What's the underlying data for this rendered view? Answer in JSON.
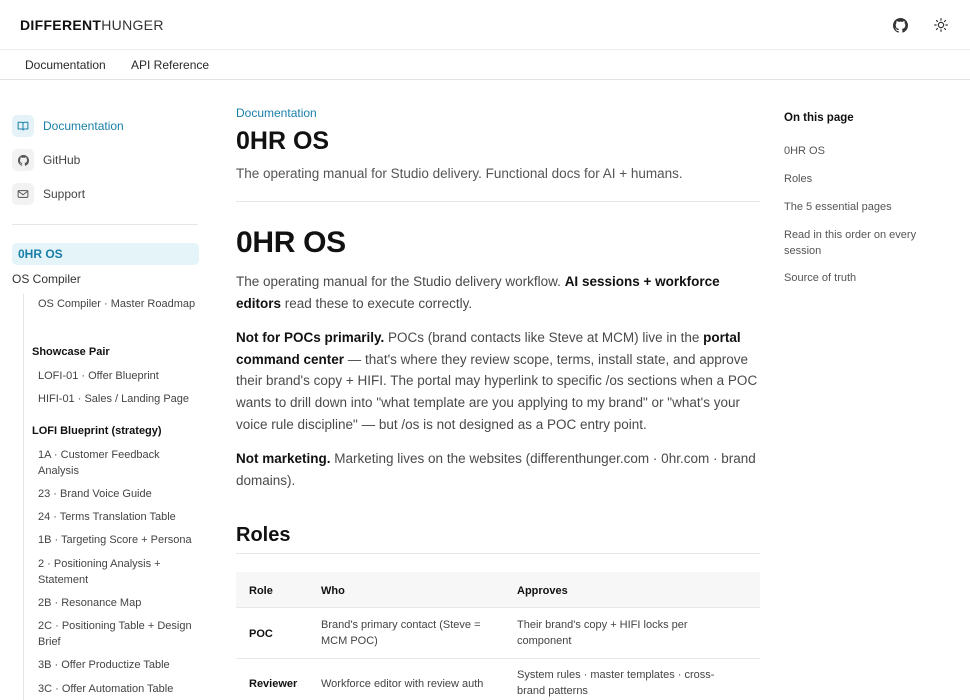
{
  "header": {
    "logo_bold": "DIFFERENT",
    "logo_thin": "HUNGER",
    "github_icon": "github-icon",
    "theme_icon": "sun-icon"
  },
  "tabs": [
    "Documentation",
    "API Reference"
  ],
  "sidebar": {
    "links": [
      {
        "label": "Documentation",
        "icon": "book-icon"
      },
      {
        "label": "GitHub",
        "icon": "github-icon"
      },
      {
        "label": "Support",
        "icon": "mail-icon"
      }
    ],
    "nav_active": "0HR OS",
    "nav_top": "OS Compiler",
    "nav_items": {
      "compiler_roadmap": "OS Compiler · Master Roadmap",
      "showcase_group": "Showcase Pair",
      "lofi01": "LOFI-01 · Offer Blueprint",
      "hifi01": "HIFI-01 · Sales / Landing Page",
      "lofi_group": "LOFI Blueprint (strategy)",
      "i1a": "1A · Customer Feedback Analysis",
      "i23": "23 · Brand Voice Guide",
      "i24": "24 · Terms Translation Table",
      "i1b": "1B · Targeting Score + Persona",
      "i2": "2 · Positioning Analysis + Statement",
      "i2b": "2B · Resonance Map",
      "i2c": "2C · Positioning Table + Design Brief",
      "i3b": "3B · Offer Productize Table",
      "i3c": "3C · Offer Automation Table"
    }
  },
  "main": {
    "breadcrumb": "Documentation",
    "title": "0HR OS",
    "subtitle": "The operating manual for Studio delivery. Functional docs for AI + humans.",
    "h1": "0HR OS",
    "p1_a": "The operating manual for the Studio delivery workflow. ",
    "p1_b": "AI sessions + workforce editors",
    "p1_c": " read these to execute correctly.",
    "p2_a": "Not for POCs primarily.",
    "p2_b": " POCs (brand contacts like Steve at MCM) live in the ",
    "p2_c": "portal command center",
    "p2_d": " — that's where they review scope, terms, install state, and approve their brand's copy + HIFI. The portal may hyperlink to specific /os sections when a POC wants to drill down into \"what template are you applying to my brand\" or \"what's your voice rule discipline\" — but /os is not designed as a POC entry point.",
    "p3_a": "Not marketing.",
    "p3_b": " Marketing lives on the websites (differenthunger.com · 0hr.com · brand domains).",
    "roles_heading": "Roles",
    "table": {
      "headers": [
        "Role",
        "Who",
        "Approves"
      ],
      "rows": [
        [
          "POC",
          "Brand's primary contact (Steve = MCM POC)",
          "Their brand's copy + HIFI locks per component"
        ],
        [
          "Reviewer",
          "Workforce editor with review auth",
          "System rules · master templates · cross-brand patterns"
        ]
      ]
    }
  },
  "toc": {
    "title": "On this page",
    "items": [
      "0HR OS",
      "Roles",
      "The 5 essential pages",
      "Read in this order on every session",
      "Source of truth"
    ]
  }
}
